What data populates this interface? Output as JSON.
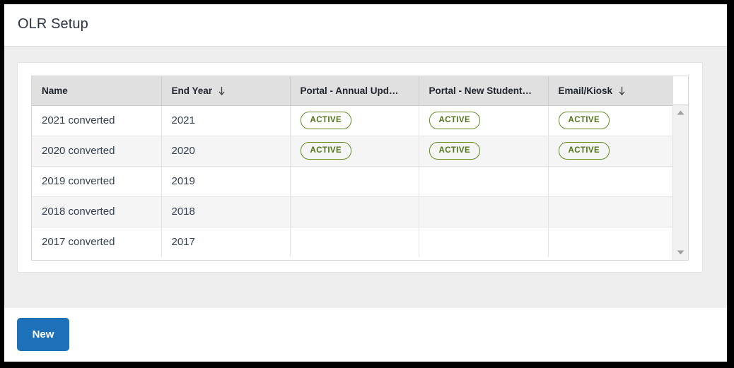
{
  "header": {
    "title": "OLR Setup"
  },
  "table": {
    "columns": [
      {
        "key": "name",
        "label": "Name",
        "sorted": false,
        "sort_icon": "arrow-down-icon"
      },
      {
        "key": "year",
        "label": "End Year",
        "sorted": true,
        "sort_icon": "arrow-down-icon"
      },
      {
        "key": "annual",
        "label": "Portal - Annual Upd…",
        "sorted": false,
        "sort_icon": "arrow-down-icon"
      },
      {
        "key": "newstu",
        "label": "Portal - New Student…",
        "sorted": false,
        "sort_icon": "arrow-down-icon"
      },
      {
        "key": "email",
        "label": "Email/Kiosk",
        "sorted": true,
        "sort_icon": "arrow-down-icon"
      }
    ],
    "rows": [
      {
        "name": "2021 converted",
        "year": "2021",
        "annual": "ACTIVE",
        "newstu": "ACTIVE",
        "email": "ACTIVE"
      },
      {
        "name": "2020 converted",
        "year": "2020",
        "annual": "ACTIVE",
        "newstu": "ACTIVE",
        "email": "ACTIVE"
      },
      {
        "name": "2019 converted",
        "year": "2019",
        "annual": "",
        "newstu": "",
        "email": ""
      },
      {
        "name": "2018 converted",
        "year": "2018",
        "annual": "",
        "newstu": "",
        "email": ""
      },
      {
        "name": "2017 converted",
        "year": "2017",
        "annual": "",
        "newstu": "",
        "email": ""
      }
    ],
    "scrollbar": {
      "up_icon": "triangle-up-icon",
      "down_icon": "triangle-down-icon"
    }
  },
  "footer": {
    "new_label": "New"
  },
  "colors": {
    "accent_button": "#1d71b8",
    "status_active": "#628c20",
    "header_bg": "#e0e0e0",
    "page_bg": "#eeeeee"
  }
}
